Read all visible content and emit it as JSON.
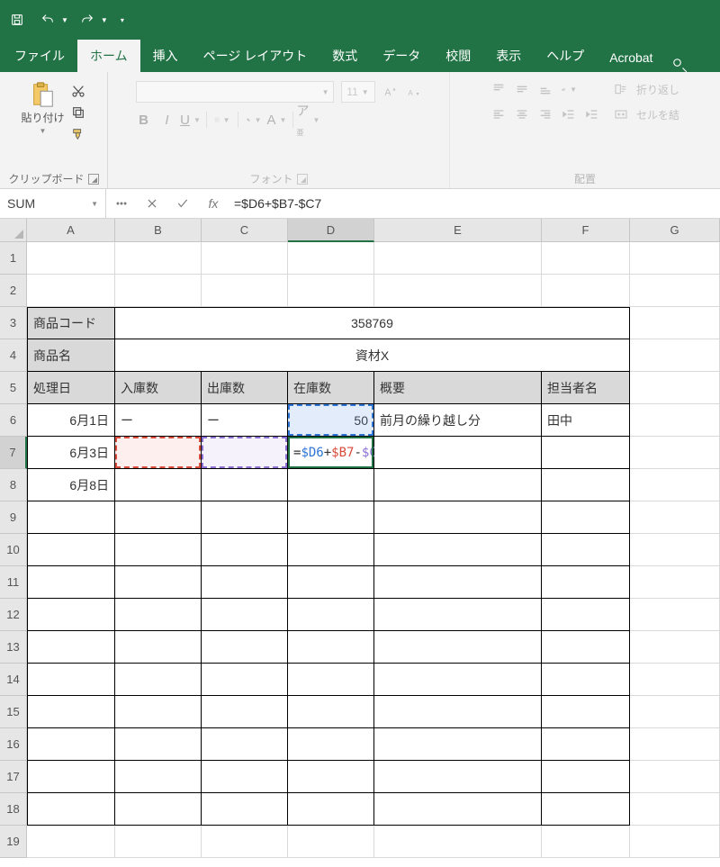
{
  "qat": {
    "save": "save-icon",
    "undo": "undo-icon",
    "redo": "redo-icon"
  },
  "tabs": {
    "file": "ファイル",
    "home": "ホーム",
    "insert": "挿入",
    "pagelayout": "ページ レイアウト",
    "formulas": "数式",
    "data": "データ",
    "review": "校閲",
    "view": "表示",
    "help": "ヘルプ",
    "acrobat": "Acrobat"
  },
  "ribbon": {
    "clipboard": {
      "label": "クリップボード",
      "paste": "貼り付け"
    },
    "font": {
      "label": "フォント",
      "size": "11"
    },
    "alignment": {
      "label": "配置",
      "wrap": "折り返し",
      "merge": "セルを結"
    }
  },
  "namebox": "SUM",
  "formula": "=$D6+$B7-$C7",
  "formula_parts": {
    "p1": "=",
    "p2": "$D6",
    "p3": "+",
    "p4": "$B7",
    "p5": "-",
    "p6": "$C7"
  },
  "cols": [
    "A",
    "B",
    "C",
    "D",
    "E",
    "F",
    "G"
  ],
  "rownums": [
    "1",
    "2",
    "3",
    "4",
    "5",
    "6",
    "7",
    "8",
    "9",
    "10",
    "11",
    "12",
    "13",
    "14",
    "15",
    "16",
    "17",
    "18",
    "19"
  ],
  "cells": {
    "A3": "商品コード",
    "B3": "358769",
    "A4": "商品名",
    "B4": "資材X",
    "A5": "処理日",
    "B5": "入庫数",
    "C5": "出庫数",
    "D5": "在庫数",
    "E5": "概要",
    "F5": "担当者名",
    "A6": "6月1日",
    "B6": "ー",
    "C6": "ー",
    "D6": "50",
    "E6": "前月の繰り越し分",
    "F6": "田中",
    "A7": "6月3日",
    "A8": "6月8日"
  }
}
